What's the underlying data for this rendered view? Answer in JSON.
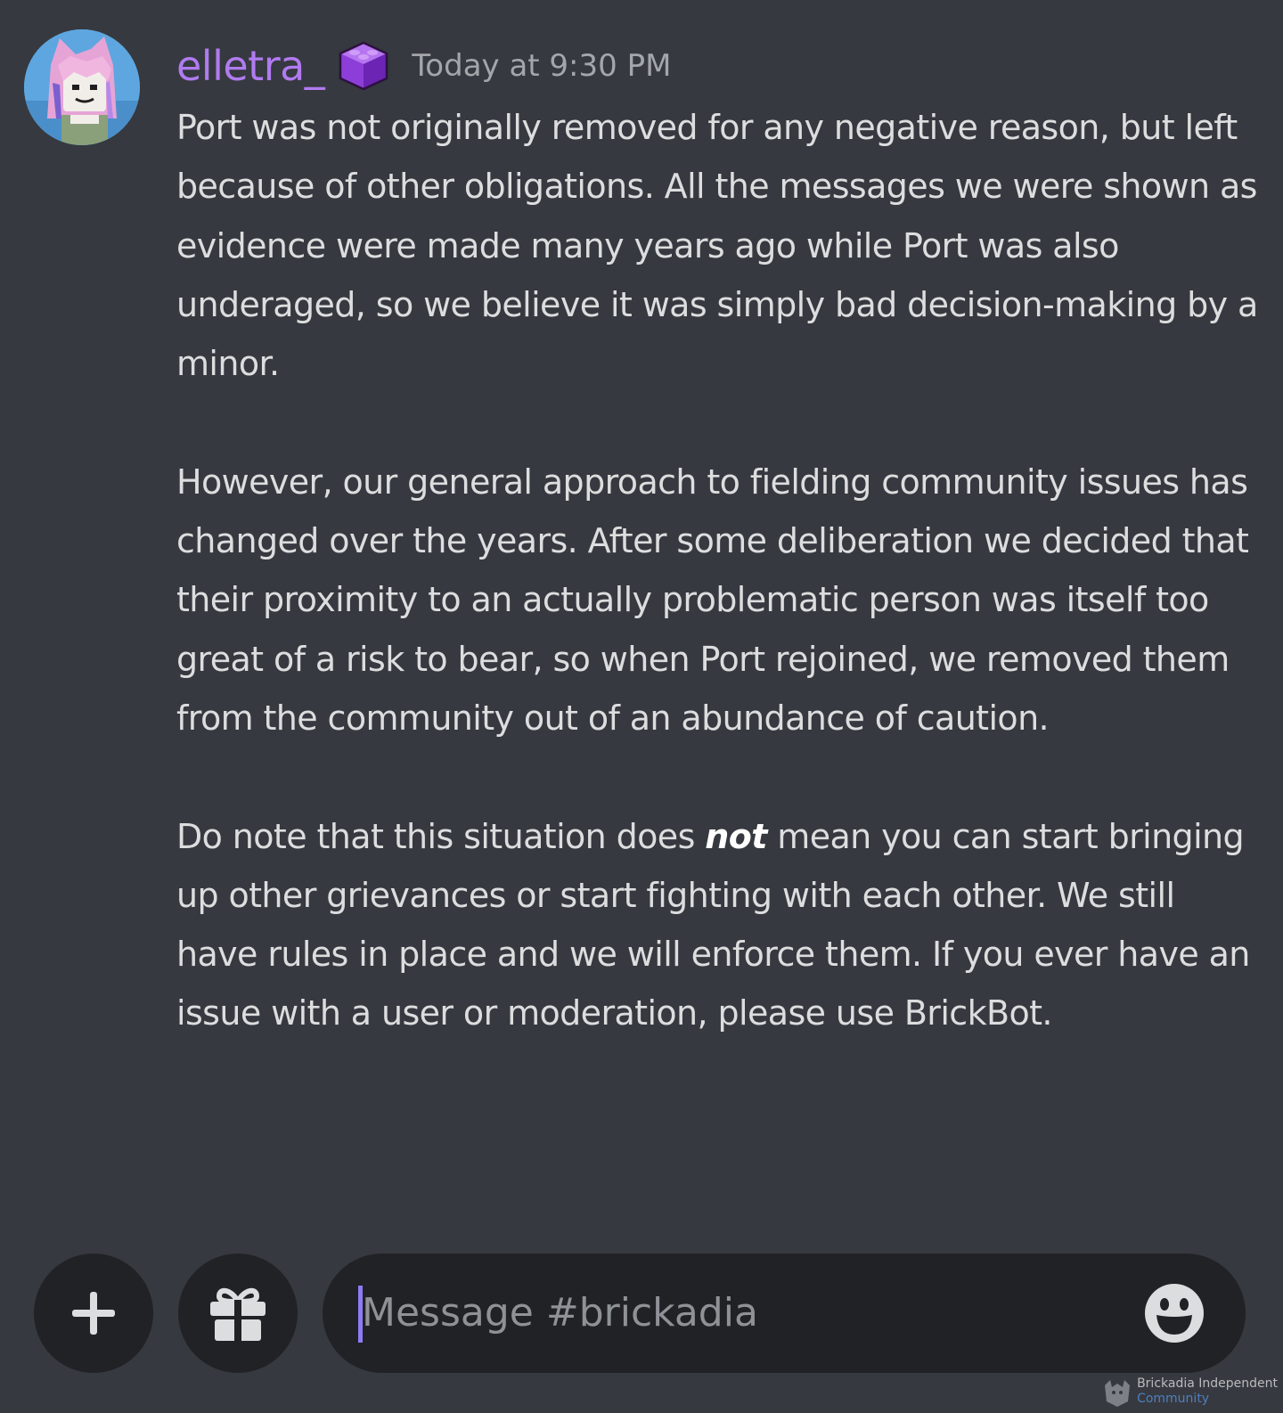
{
  "message": {
    "username": "elletra_",
    "timestamp": "Today at 9:30 PM",
    "role_badge_icon": "purple-brick-icon",
    "paragraph1": "Port was not originally removed for any negative reason, but left because of other obligations. All the messages we were shown as evidence were made many years ago while Port was also underaged, so we believe it was simply bad decision-making by a minor.",
    "paragraph2": "However, our general approach to fielding community issues has changed over the years. After some deliberation we decided that their proximity to an actually problematic person was itself too great of a risk to bear, so when Port rejoined, we removed them from the community out of an abundance of caution.",
    "paragraph3_before": "Do note that this situation does ",
    "paragraph3_emphasis": "not",
    "paragraph3_after": " mean you can start bringing up other grievances or start fighting with each other. We still have rules in place and we will enforce them. If you ever have an issue with a user or moderation, please use BrickBot."
  },
  "composer": {
    "placeholder": "Message #brickadia",
    "plus_icon": "plus-icon",
    "gift_icon": "gift-icon",
    "emoji_icon": "emoji-smile-icon"
  },
  "watermark": {
    "line1": "Brickadia Independent",
    "line2": "Community"
  },
  "colors": {
    "background": "#36393f",
    "username": "#b07bf0",
    "text": "#dcddde",
    "timestamp": "#a3a6aa",
    "input_bg": "#202225",
    "caret": "#8b7cf6"
  }
}
